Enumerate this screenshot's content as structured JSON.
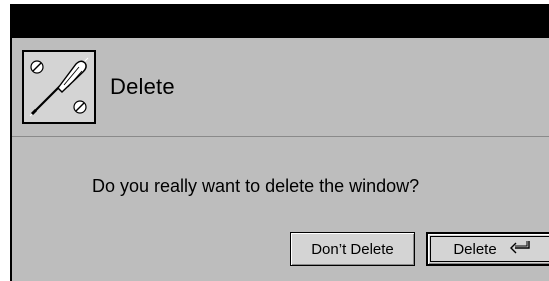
{
  "window": {
    "title": ""
  },
  "dialog": {
    "icon": "screwdriver-tool-icon",
    "title": "Delete",
    "message": "Do you really want to delete the window?",
    "buttons": {
      "cancel_label": "Don’t Delete",
      "confirm_label": "Delete",
      "confirm_icon": "return-key-icon"
    }
  },
  "colors": {
    "titlebar": "#000000",
    "dialog_background": "#bdbdbd",
    "button_face": "#d4d4d4"
  }
}
